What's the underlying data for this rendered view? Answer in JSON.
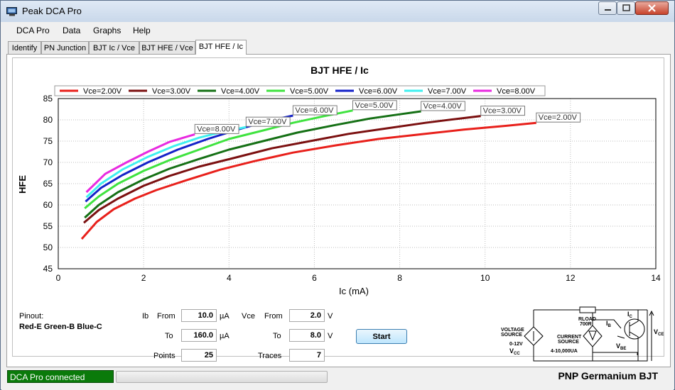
{
  "window": {
    "title": "Peak DCA Pro"
  },
  "menu": [
    "DCA Pro",
    "Data",
    "Graphs",
    "Help"
  ],
  "tabs": [
    "Identify",
    "PN Junction",
    "BJT Ic / Vce",
    "BJT HFE / Vce",
    "BJT HFE / Ic"
  ],
  "active_tab": "BJT HFE / Ic",
  "chart_data": {
    "type": "line",
    "title": "BJT HFE / Ic",
    "xlabel": "Ic (mA)",
    "ylabel": "HFE",
    "xlim": [
      0,
      14
    ],
    "ylim": [
      45,
      85
    ],
    "xticks": [
      "0",
      "2",
      "4",
      "6",
      "8",
      "10",
      "12",
      "14"
    ],
    "yticks": [
      "45",
      "50",
      "55",
      "60",
      "65",
      "70",
      "75",
      "80",
      "85"
    ],
    "grid": true,
    "legend_position": "top",
    "series": [
      {
        "name": "Vce=2.00V",
        "color": "#e8201b",
        "label": "Vce=2.00V",
        "x": [
          0.55,
          0.9,
          1.3,
          1.8,
          2.3,
          3.0,
          3.8,
          4.6,
          5.5,
          6.5,
          7.5,
          8.5,
          9.5,
          10.5,
          11.2
        ],
        "y": [
          52.0,
          56.0,
          59.0,
          61.5,
          63.5,
          65.8,
          68.3,
          70.3,
          72.3,
          74.0,
          75.5,
          76.6,
          77.7,
          78.6,
          79.3
        ]
      },
      {
        "name": "Vce=3.00V",
        "color": "#7b1010",
        "label": "Vce=3.00V",
        "x": [
          0.6,
          0.95,
          1.4,
          2.0,
          2.6,
          3.3,
          4.1,
          5.0,
          5.9,
          6.8,
          7.7,
          8.6,
          9.4,
          9.9
        ],
        "y": [
          55.8,
          58.8,
          61.5,
          64.5,
          66.8,
          69.0,
          71.0,
          73.3,
          75.0,
          76.7,
          78.0,
          79.3,
          80.3,
          80.9
        ]
      },
      {
        "name": "Vce=4.00V",
        "color": "#157015",
        "label": "Vce=4.00V",
        "x": [
          0.62,
          0.95,
          1.4,
          2.0,
          2.6,
          3.3,
          4.0,
          4.8,
          5.6,
          6.5,
          7.3,
          8.0,
          8.5
        ],
        "y": [
          57.0,
          60.0,
          63.0,
          66.0,
          68.5,
          70.8,
          73.0,
          75.0,
          77.0,
          78.8,
          80.3,
          81.3,
          82.0
        ]
      },
      {
        "name": "Vce=5.00V",
        "color": "#3fe33f",
        "label": "Vce=5.00V",
        "x": [
          0.62,
          0.95,
          1.4,
          2.0,
          2.6,
          3.3,
          4.0,
          4.8,
          5.5,
          6.2,
          6.9
        ],
        "y": [
          59.2,
          62.0,
          65.0,
          68.0,
          70.5,
          73.0,
          75.5,
          77.5,
          79.3,
          80.8,
          82.2
        ]
      },
      {
        "name": "Vce=6.00V",
        "color": "#1422c8",
        "label": "Vce=6.00V",
        "x": [
          0.64,
          1.0,
          1.5,
          2.1,
          2.8,
          3.5,
          4.2,
          4.9,
          5.5
        ],
        "y": [
          60.8,
          64.0,
          67.0,
          70.0,
          73.0,
          75.5,
          77.7,
          79.7,
          81.0
        ]
      },
      {
        "name": "Vce=7.00V",
        "color": "#3ff0f0",
        "label": "Vce=7.00V",
        "x": [
          0.66,
          1.0,
          1.5,
          2.1,
          2.7,
          3.3,
          3.9,
          4.4
        ],
        "y": [
          61.8,
          65.0,
          68.3,
          71.3,
          73.8,
          75.8,
          77.3,
          78.3
        ]
      },
      {
        "name": "Vce=8.00V",
        "color": "#e82ae0",
        "label": "Vce=8.00V",
        "x": [
          0.66,
          1.1,
          1.6,
          2.1,
          2.6,
          3.2
        ],
        "y": [
          63.0,
          67.3,
          70.0,
          72.5,
          74.8,
          76.6
        ]
      }
    ]
  },
  "pinout": {
    "label": "Pinout:",
    "value": "Red-E Green-B Blue-C"
  },
  "controls": {
    "ib_label": "Ib",
    "ib_from_label": "From",
    "ib_from": "10.0",
    "ib_unit1": "µA",
    "ib_to_label": "To",
    "ib_to": "160.0",
    "ib_unit2": "µA",
    "points_label": "Points",
    "points": "25",
    "vce_label": "Vce",
    "vce_from_label": "From",
    "vce_from": "2.0",
    "vce_unit1": "V",
    "vce_to_label": "To",
    "vce_to": "8.0",
    "vce_unit2": "V",
    "traces_label": "Traces",
    "traces": "7",
    "start_label": "Start"
  },
  "schematic": {
    "rload": "RLOAD",
    "rload_val": "700R",
    "voltage_source": "VOLTAGE",
    "voltage_source2": "SOURCE",
    "voltage_range": "0-12V",
    "vcc": "V",
    "vcc_sub": "CC",
    "current_source": "CURRENT",
    "current_source2": "SOURCE",
    "current_range": "4-10,000UA",
    "ib": "I",
    "ib_sub": "B",
    "ic": "I",
    "ic_sub": "C",
    "vbe": "V",
    "vbe_sub": "BE",
    "vce": "V",
    "vce_sub": "CE"
  },
  "status": {
    "connection": "DCA Pro connected",
    "device": "PNP Germanium BJT"
  }
}
